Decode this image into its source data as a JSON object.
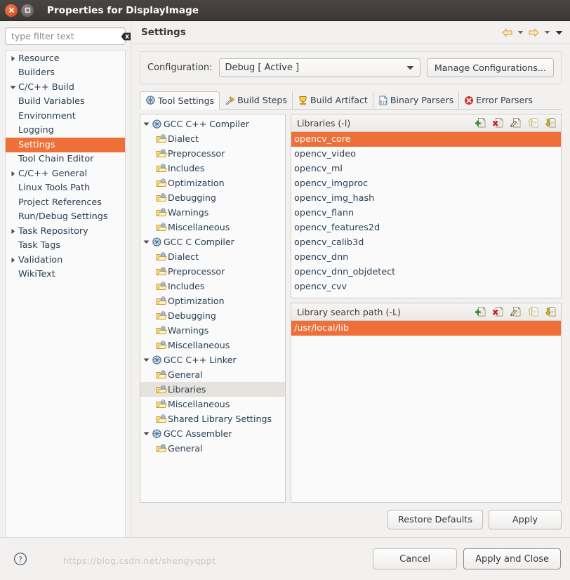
{
  "window": {
    "title": "Properties for DisplayImage",
    "close_icon": "close-icon",
    "maximize_icon": "maximize-icon"
  },
  "filter": {
    "placeholder": "type filter text",
    "value": "",
    "clear_icon": "clear-icon"
  },
  "sidebar": {
    "items": [
      {
        "label": "Resource",
        "depth": 0,
        "twisty": "collapsed",
        "selected": false
      },
      {
        "label": "Builders",
        "depth": 0,
        "twisty": "none",
        "selected": false
      },
      {
        "label": "C/C++ Build",
        "depth": 0,
        "twisty": "expanded",
        "selected": false
      },
      {
        "label": "Build Variables",
        "depth": 1,
        "twisty": "none",
        "selected": false
      },
      {
        "label": "Environment",
        "depth": 1,
        "twisty": "none",
        "selected": false
      },
      {
        "label": "Logging",
        "depth": 1,
        "twisty": "none",
        "selected": false
      },
      {
        "label": "Settings",
        "depth": 1,
        "twisty": "none",
        "selected": true
      },
      {
        "label": "Tool Chain Editor",
        "depth": 1,
        "twisty": "none",
        "selected": false
      },
      {
        "label": "C/C++ General",
        "depth": 0,
        "twisty": "collapsed",
        "selected": false
      },
      {
        "label": "Linux Tools Path",
        "depth": 0,
        "twisty": "none",
        "selected": false
      },
      {
        "label": "Project References",
        "depth": 0,
        "twisty": "none",
        "selected": false
      },
      {
        "label": "Run/Debug Settings",
        "depth": 0,
        "twisty": "none",
        "selected": false
      },
      {
        "label": "Task Repository",
        "depth": 0,
        "twisty": "collapsed",
        "selected": false
      },
      {
        "label": "Task Tags",
        "depth": 0,
        "twisty": "none",
        "selected": false
      },
      {
        "label": "Validation",
        "depth": 0,
        "twisty": "collapsed",
        "selected": false
      },
      {
        "label": "WikiText",
        "depth": 0,
        "twisty": "none",
        "selected": false
      }
    ]
  },
  "page": {
    "title": "Settings",
    "nav": {
      "back_icon": "back-arrow-icon",
      "back_menu_icon": "chevron-down-icon",
      "forward_icon": "forward-arrow-icon",
      "forward_menu_icon": "chevron-down-icon",
      "menu_icon": "view-menu-icon"
    },
    "configuration": {
      "label": "Configuration:",
      "value": "Debug  [ Active ]",
      "dropdown_icon": "chevron-down-icon",
      "manage_button": "Manage Configurations..."
    },
    "tabs": [
      {
        "label": "Tool Settings",
        "icon": "tool-settings-icon",
        "active": true
      },
      {
        "label": "Build Steps",
        "icon": "build-steps-icon",
        "active": false
      },
      {
        "label": "Build Artifact",
        "icon": "build-artifact-icon",
        "active": false
      },
      {
        "label": "Binary Parsers",
        "icon": "binary-parsers-icon",
        "active": false
      },
      {
        "label": "Error Parsers",
        "icon": "error-parsers-icon",
        "active": false
      }
    ],
    "tool_tree": [
      {
        "label": "GCC C++ Compiler",
        "type": "tool",
        "twisty": "expanded",
        "selected": false
      },
      {
        "label": "Dialect",
        "type": "folder",
        "twisty": "none",
        "selected": false
      },
      {
        "label": "Preprocessor",
        "type": "folder",
        "twisty": "none",
        "selected": false
      },
      {
        "label": "Includes",
        "type": "folder",
        "twisty": "none",
        "selected": false
      },
      {
        "label": "Optimization",
        "type": "folder",
        "twisty": "none",
        "selected": false
      },
      {
        "label": "Debugging",
        "type": "folder",
        "twisty": "none",
        "selected": false
      },
      {
        "label": "Warnings",
        "type": "folder",
        "twisty": "none",
        "selected": false
      },
      {
        "label": "Miscellaneous",
        "type": "folder",
        "twisty": "none",
        "selected": false
      },
      {
        "label": "GCC C Compiler",
        "type": "tool",
        "twisty": "expanded",
        "selected": false
      },
      {
        "label": "Dialect",
        "type": "folder",
        "twisty": "none",
        "selected": false
      },
      {
        "label": "Preprocessor",
        "type": "folder",
        "twisty": "none",
        "selected": false
      },
      {
        "label": "Includes",
        "type": "folder",
        "twisty": "none",
        "selected": false
      },
      {
        "label": "Optimization",
        "type": "folder",
        "twisty": "none",
        "selected": false
      },
      {
        "label": "Debugging",
        "type": "folder",
        "twisty": "none",
        "selected": false
      },
      {
        "label": "Warnings",
        "type": "folder",
        "twisty": "none",
        "selected": false
      },
      {
        "label": "Miscellaneous",
        "type": "folder",
        "twisty": "none",
        "selected": false
      },
      {
        "label": "GCC C++ Linker",
        "type": "tool",
        "twisty": "expanded",
        "selected": false
      },
      {
        "label": "General",
        "type": "folder",
        "twisty": "none",
        "selected": false
      },
      {
        "label": "Libraries",
        "type": "folder",
        "twisty": "none",
        "selected": true
      },
      {
        "label": "Miscellaneous",
        "type": "folder",
        "twisty": "none",
        "selected": false
      },
      {
        "label": "Shared Library Settings",
        "type": "folder",
        "twisty": "none",
        "selected": false
      },
      {
        "label": "GCC Assembler",
        "type": "tool",
        "twisty": "expanded",
        "selected": false
      },
      {
        "label": "General",
        "type": "folder",
        "twisty": "none",
        "selected": false
      }
    ],
    "libraries_panel": {
      "title": "Libraries (-l)",
      "tools": [
        {
          "icon": "add-icon",
          "name": "add"
        },
        {
          "icon": "delete-icon",
          "name": "delete"
        },
        {
          "icon": "edit-icon",
          "name": "edit"
        },
        {
          "icon": "move-up-icon",
          "name": "move-up"
        },
        {
          "icon": "move-down-icon",
          "name": "move-down"
        }
      ],
      "items": [
        {
          "label": "opencv_core",
          "selected": true
        },
        {
          "label": "opencv_video",
          "selected": false
        },
        {
          "label": "opencv_ml",
          "selected": false
        },
        {
          "label": "opencv_imgproc",
          "selected": false
        },
        {
          "label": "opencv_img_hash",
          "selected": false
        },
        {
          "label": "opencv_flann",
          "selected": false
        },
        {
          "label": "opencv_features2d",
          "selected": false
        },
        {
          "label": "opencv_calib3d",
          "selected": false
        },
        {
          "label": "opencv_dnn",
          "selected": false
        },
        {
          "label": "opencv_dnn_objdetect",
          "selected": false
        },
        {
          "label": "opencv_cvv",
          "selected": false
        }
      ]
    },
    "search_path_panel": {
      "title": "Library search path (-L)",
      "tools": [
        {
          "icon": "add-icon",
          "name": "add"
        },
        {
          "icon": "delete-icon",
          "name": "delete"
        },
        {
          "icon": "edit-icon",
          "name": "edit"
        },
        {
          "icon": "move-up-icon",
          "name": "move-up"
        },
        {
          "icon": "move-down-icon",
          "name": "move-down"
        }
      ],
      "items": [
        {
          "label": "/usr/local/lib",
          "selected": true
        }
      ]
    },
    "page_buttons": {
      "restore_defaults": "Restore Defaults",
      "apply": "Apply"
    }
  },
  "footer": {
    "help_icon": "help-icon",
    "cancel": "Cancel",
    "apply_and_close": "Apply and Close",
    "watermark": "https://blog.csdn.net/shengyqppt"
  },
  "colors": {
    "selection_orange": "#ef6f39",
    "titlebar": "#3c3836",
    "tree_selection_gray": "#e6e2dd",
    "panel_bg": "#f2f1f0"
  }
}
